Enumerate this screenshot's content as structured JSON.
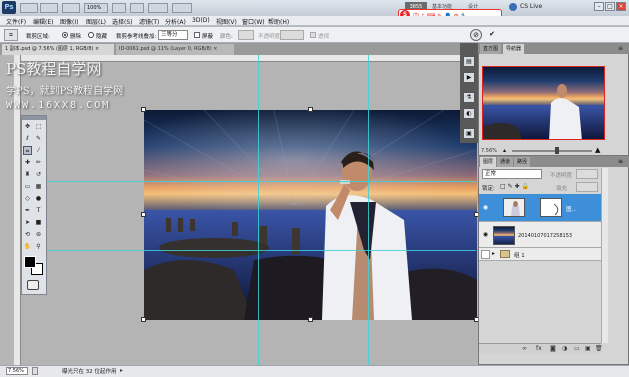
{
  "titlebar": {
    "app_logo": "Ps",
    "zoom_dropdown": "100%",
    "workspace_active": "3855",
    "workspace_items": [
      "基本功能",
      "设计"
    ],
    "cs_live": "CS Live",
    "window_buttons": [
      "minimize",
      "maximize",
      "close"
    ]
  },
  "menubar": [
    "文件(F)",
    "编辑(E)",
    "图像(I)",
    "图层(L)",
    "选择(S)",
    "滤镜(T)",
    "分析(A)",
    "3D(D)",
    "视图(V)",
    "窗口(W)",
    "帮助(H)"
  ],
  "options": {
    "crop_region_label": "裁剪区域:",
    "delete_label": "删除",
    "hide_label": "隐藏",
    "overlay_label": "裁剪参考线叠加:",
    "overlay_value": "三等分",
    "shield_label": "屏蔽",
    "color_label": "颜色:",
    "opacity_label": "不透明度",
    "perspective_label": "透视"
  },
  "doc_tabs": [
    "1 副本.psd @ 7.56% (图层 1, RGB/8) ×",
    "ID-0061.psd @ 11% (Layer 0, RGB/8) ×"
  ],
  "watermark": {
    "line1": "PS教程自学网",
    "line2": "学PS，就到PS教程自学网",
    "line3": "WWW.16XX8.COM"
  },
  "tools": [
    "move",
    "marquee",
    "lasso",
    "quick-select",
    "crop",
    "eyedropper",
    "heal",
    "brush",
    "stamp",
    "history",
    "eraser",
    "gradient",
    "blur",
    "dodge",
    "pen",
    "type",
    "path-select",
    "shape",
    "3d-rotate",
    "3d-orbit",
    "hand",
    "zoom"
  ],
  "status": {
    "zoom": "7.56%",
    "text": "曝光只在 32 位起作用"
  },
  "navigator": {
    "tabs": [
      "直方图",
      "导航器"
    ],
    "zoom": "7.56%"
  },
  "layers_panel": {
    "tabs": [
      "图层",
      "通道",
      "路径"
    ],
    "blend_mode": "正常",
    "opacity_label": "不透明度",
    "lock_label": "锁定:",
    "fill_label": "填充",
    "layers": [
      {
        "name": "图...",
        "selected": true
      },
      {
        "name": "20140107017258153",
        "selected": false
      },
      {
        "name": "组 1",
        "selected": false
      }
    ],
    "bottom_icons": [
      "link-icon",
      "fx-icon",
      "mask-icon",
      "adjustment-icon",
      "group-icon",
      "new-layer-icon",
      "trash-icon"
    ]
  },
  "colors": {
    "guide": "#39d2d8",
    "selected_layer": "#3d8fd9",
    "brand_red": "#e22222"
  }
}
